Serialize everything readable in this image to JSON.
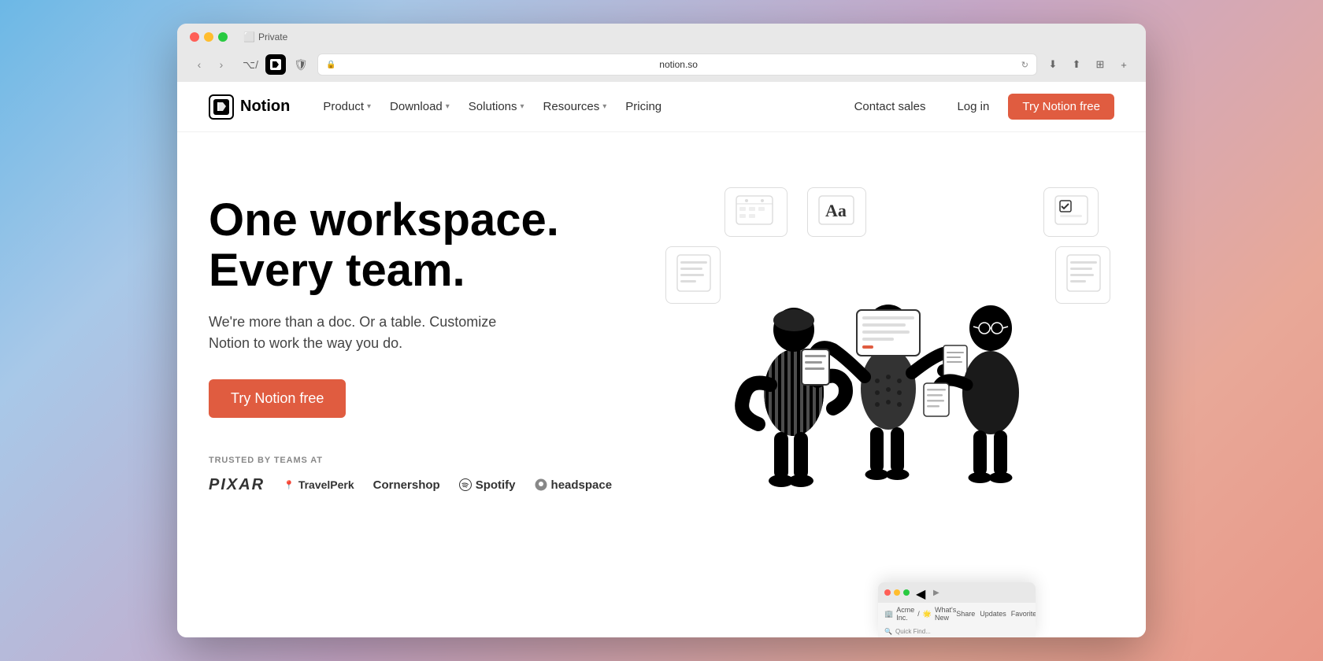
{
  "browser": {
    "traffic_lights": {
      "close": "close",
      "minimize": "minimize",
      "maximize": "maximize"
    },
    "tab_label": "Private",
    "address": "notion.so",
    "nav_back": "‹",
    "nav_forward": "›"
  },
  "navbar": {
    "brand_name": "Notion",
    "nav_items": [
      {
        "label": "Product",
        "has_dropdown": true
      },
      {
        "label": "Download",
        "has_dropdown": true
      },
      {
        "label": "Solutions",
        "has_dropdown": true
      },
      {
        "label": "Resources",
        "has_dropdown": true
      },
      {
        "label": "Pricing",
        "has_dropdown": false
      }
    ],
    "actions": {
      "contact_sales": "Contact sales",
      "log_in": "Log in",
      "try_free": "Try Notion free"
    }
  },
  "hero": {
    "title_line1": "One workspace.",
    "title_line2": "Every team.",
    "subtitle": "We're more than a doc. Or a table. Customize Notion to work the way you do.",
    "cta_button": "Try Notion free",
    "trusted_label": "TRUSTED BY TEAMS AT",
    "companies": [
      {
        "name": "PIXAR",
        "style": "pixar"
      },
      {
        "name": "TravelPerk",
        "style": "travelperk",
        "has_pin": true
      },
      {
        "name": "Cornershop",
        "style": "cornershop"
      },
      {
        "name": "Spotify",
        "style": "spotify",
        "has_circle": true
      },
      {
        "name": "headspace",
        "style": "headspace",
        "has_dot": true
      }
    ]
  },
  "nested_browser": {
    "breadcrumb": "Acme Inc. / 🌟 What's New",
    "actions": [
      "Share",
      "Updates",
      "Favorite",
      "..."
    ]
  }
}
